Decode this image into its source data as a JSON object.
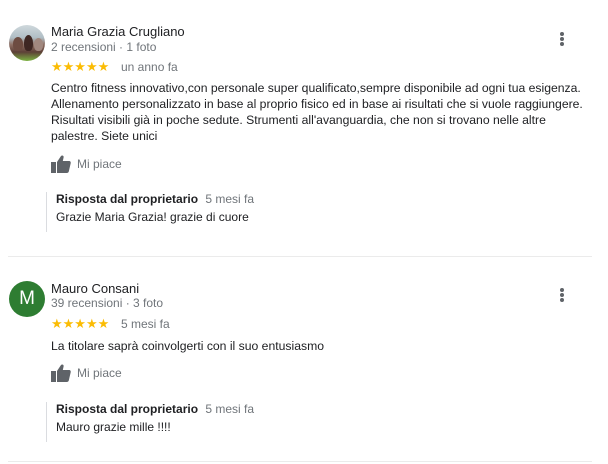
{
  "reviews": [
    {
      "name": "Maria Grazia Crugliano",
      "meta": "2 recensioni · 1 foto",
      "stars": "★★★★★",
      "date": "un anno fa",
      "text": "Centro fitness innovativo,con personale super qualificato,sempre disponibile ad ogni tua esigenza. Allenamento personalizzato in base al proprio fisico ed in base ai risultati che si vuole raggiungere. Risultati visibili già in poche sedute. Strumenti all'avanguardia, che non si trovano nelle altre palestre. Siete unici",
      "like_label": "Mi piace",
      "reply": {
        "owner_label": "Risposta dal proprietario",
        "date": "5 mesi fa",
        "text": "Grazie Maria Grazia! grazie di cuore"
      }
    },
    {
      "avatar_letter": "M",
      "name": "Mauro Consani",
      "meta": "39 recensioni · 3 foto",
      "stars": "★★★★★",
      "date": "5 mesi fa",
      "text": "La titolare saprà coinvolgerti con il suo entusiasmo",
      "like_label": "Mi piace",
      "reply": {
        "owner_label": "Risposta dal proprietario",
        "date": "5 mesi fa",
        "text": "Mauro grazie mille !!!!"
      }
    }
  ],
  "colors": {
    "star": "#fbbc04",
    "avatar_green": "#2e7d32",
    "muted_text": "#70757a"
  },
  "icons": [
    "more-vert-icon",
    "thumb-up-icon"
  ]
}
